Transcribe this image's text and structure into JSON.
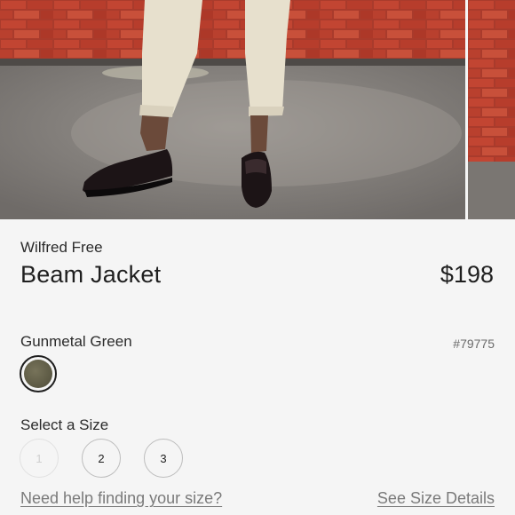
{
  "product": {
    "brand": "Wilfred Free",
    "name": "Beam Jacket",
    "price": "$198"
  },
  "color": {
    "label": "Gunmetal Green",
    "sku": "#79775",
    "swatch_hex": "#66634c"
  },
  "size": {
    "label": "Select a Size",
    "options": [
      {
        "value": "1",
        "available": false
      },
      {
        "value": "2",
        "available": true
      },
      {
        "value": "3",
        "available": true
      }
    ]
  },
  "links": {
    "help": "Need help finding your size?",
    "details": "See Size Details"
  },
  "colors": {
    "brick": "#b33a2a",
    "asphalt": "#7a7672",
    "pants": "#e6dfcc",
    "shoes": "#1c1416"
  }
}
